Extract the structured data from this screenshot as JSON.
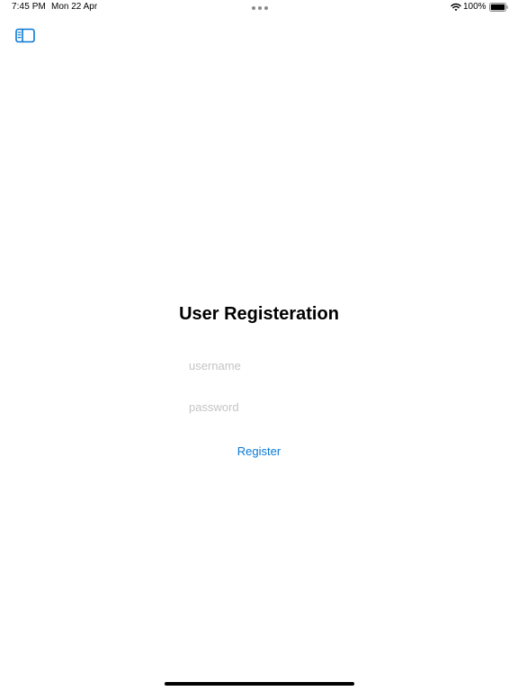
{
  "status_bar": {
    "time": "7:45 PM",
    "date": "Mon 22 Apr",
    "battery_percent": "100%",
    "battery_level": 1.0,
    "icons": [
      "wifi-icon",
      "battery-icon",
      "multitask-dots-icon"
    ]
  },
  "nav": {
    "sidebar_toggle_icon": "sidebar-toggle-icon"
  },
  "form": {
    "title": "User Registeration",
    "username": {
      "value": "",
      "placeholder": "username"
    },
    "password": {
      "value": "",
      "placeholder": "password"
    },
    "register_label": "Register"
  },
  "colors": {
    "accent": "#0a78d4",
    "placeholder": "#c4c4c6",
    "background": "#ffffff"
  }
}
